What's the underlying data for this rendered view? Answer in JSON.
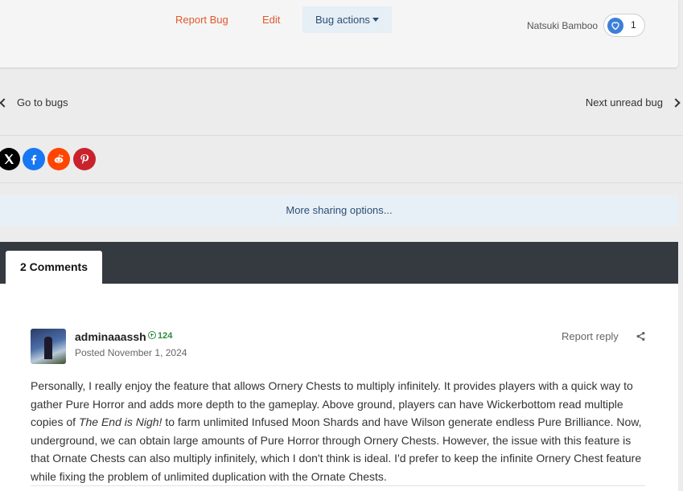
{
  "actions": {
    "report_bug": "Report Bug",
    "edit": "Edit",
    "bug_actions": "Bug actions"
  },
  "reaction": {
    "user": "Natsuki Bamboo",
    "count": "1"
  },
  "nav": {
    "prev": "Go to bugs",
    "next": "Next unread bug"
  },
  "share": {
    "more_options": "More sharing options..."
  },
  "comments": {
    "tab_label": "2 Comments"
  },
  "comment": {
    "author": "adminaaassh",
    "reputation": "124",
    "posted_prefix": "Posted",
    "posted_date": "November 1, 2024",
    "report_label": "Report reply",
    "body_part1": "Personally, I really enjoy the feature that allows Ornery Chests to multiply infinitely. It provides players with a quick way to gather Pure Horror and adds more depth to the gameplay. Above ground, players can have Wickerbottom read multiple copies of ",
    "body_italic": "The End is Nigh!",
    "body_part2": " to farm unlimited Infused Moon Shards and have Wilson generate endless Pure Brilliance. Now, underground, we can obtain large amounts of Pure Horror through Ornery Chests. However, the issue with this feature is that Ornate Chests can also multiply infinitely, which I don't think is ideal. I'd prefer to keep the infinite Ornery Chest feature while fixing the problem of unlimited duplication with the Ornate Chests."
  },
  "colors": {
    "accent": "#e0592f",
    "link_blue": "#2b4f75",
    "dark_bar": "#353a40",
    "rep_green": "#2b8a3e"
  }
}
